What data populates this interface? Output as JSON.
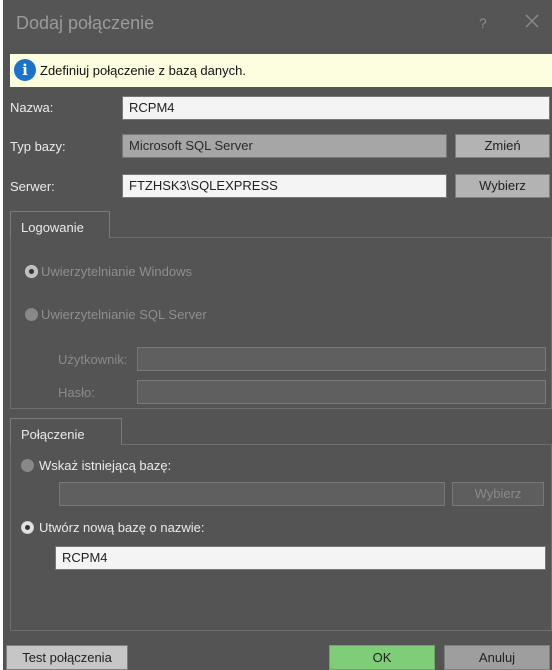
{
  "window": {
    "title": "Dodaj połączenie",
    "help": "?"
  },
  "info": {
    "text": "Zdefiniuj połączenie z bazą danych."
  },
  "form": {
    "name_label": "Nazwa:",
    "name_value": "RCPM4",
    "dbtype_label": "Typ bazy:",
    "dbtype_value": "Microsoft SQL Server",
    "change_button": "Zmień",
    "server_label": "Serwer:",
    "server_value": "FTZHSK3\\SQLEXPRESS",
    "choose_button": "Wybierz"
  },
  "login": {
    "tab": "Logowanie",
    "windows_auth": "Uwierzytelnianie Windows",
    "sql_auth": "Uwierzytelnianie SQL Server",
    "user_label": "Użytkownik:",
    "user_value": "",
    "password_label": "Hasło:",
    "password_value": ""
  },
  "connection": {
    "tab": "Połączenie",
    "existing_label": "Wskaż istniejącą bazę:",
    "existing_value": "",
    "existing_button": "Wybierz",
    "new_label": "Utwórz nową bazę o nazwie:",
    "new_value": "RCPM4"
  },
  "buttons": {
    "test": "Test połączenia",
    "ok": "OK",
    "cancel": "Anuluj"
  },
  "colors": {
    "ok_green": "#7fcc79",
    "info_blue": "#1a73c8",
    "info_bg": "#fdfde0",
    "window_bg": "#545454"
  }
}
